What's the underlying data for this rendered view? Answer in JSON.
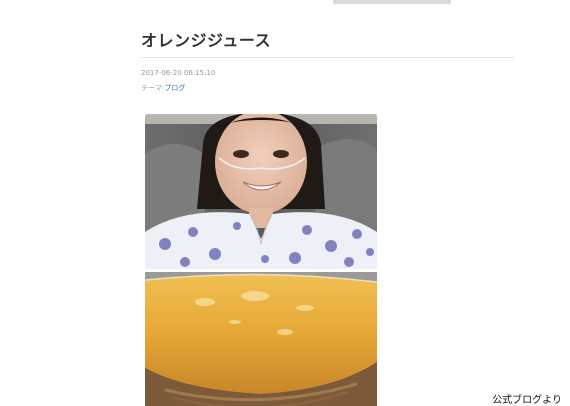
{
  "entry": {
    "title": "オレンジジュース",
    "date": "2017-06-20 06:15:10",
    "theme_label": "テーマ:",
    "theme_link": "ブログ"
  },
  "credit": "公式ブログより"
}
